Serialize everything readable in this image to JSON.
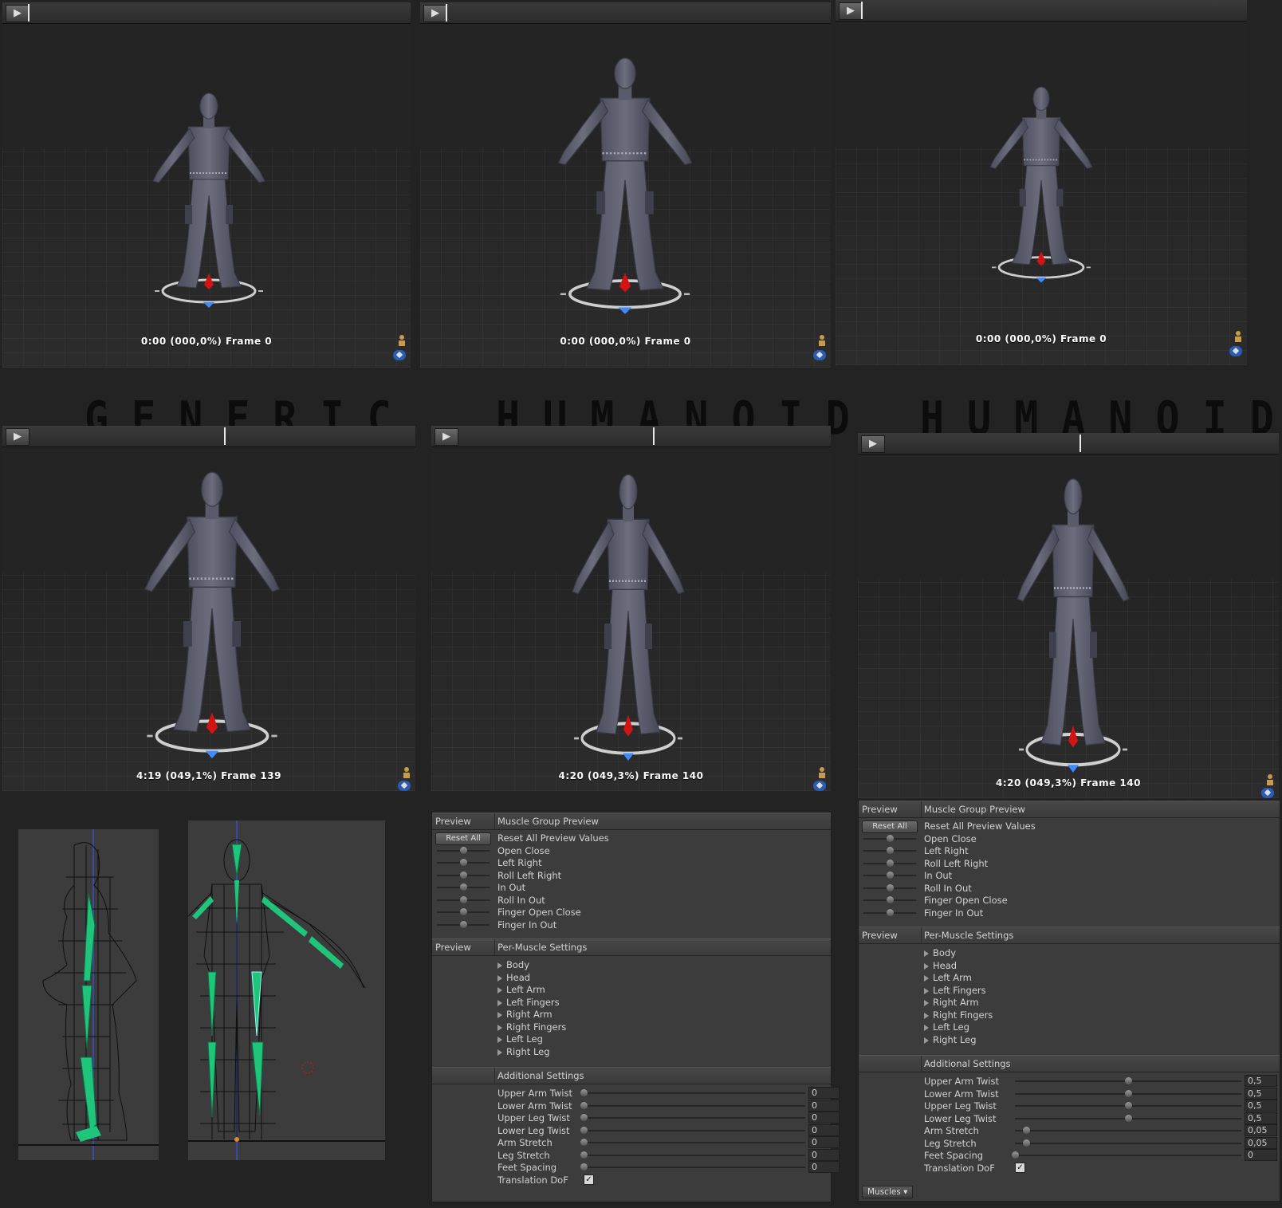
{
  "headers": [
    "GENERIC",
    "HUMANOID",
    "HUMANOID"
  ],
  "viewports": [
    {
      "time": "0:00 (000,0%) Frame 0"
    },
    {
      "time": "0:00 (000,0%) Frame 0"
    },
    {
      "time": "0:00 (000,0%) Frame 0"
    },
    {
      "time": "4:19 (049,1%) Frame 139"
    },
    {
      "time": "4:20 (049,3%) Frame 140"
    },
    {
      "time": "4:20 (049,3%) Frame 140"
    }
  ],
  "inspector_left": {
    "muscle_group": {
      "col_label": "Preview",
      "title": "Muscle Group Preview",
      "reset_button": "Reset All",
      "reset_label": "Reset All Preview Values",
      "items": [
        "Open Close",
        "Left Right",
        "Roll Left Right",
        "In Out",
        "Roll In Out",
        "Finger Open Close",
        "Finger In Out"
      ]
    },
    "per_muscle": {
      "col_label": "Preview",
      "title": "Per-Muscle Settings",
      "items": [
        "Body",
        "Head",
        "Left Arm",
        "Left Fingers",
        "Right Arm",
        "Right Fingers",
        "Left Leg",
        "Right Leg"
      ]
    },
    "additional": {
      "title": "Additional Settings",
      "rows": [
        {
          "label": "Upper Arm Twist",
          "value": "0",
          "fraction": 0
        },
        {
          "label": "Lower Arm Twist",
          "value": "0",
          "fraction": 0
        },
        {
          "label": "Upper Leg Twist",
          "value": "0",
          "fraction": 0
        },
        {
          "label": "Lower Leg Twist",
          "value": "0",
          "fraction": 0
        },
        {
          "label": "Arm Stretch",
          "value": "0",
          "fraction": 0
        },
        {
          "label": "Leg Stretch",
          "value": "0",
          "fraction": 0
        },
        {
          "label": "Feet Spacing",
          "value": "0",
          "fraction": 0
        }
      ],
      "translation_dof": "Translation DoF",
      "translation_checked": true
    }
  },
  "inspector_right": {
    "muscle_group": {
      "col_label": "Preview",
      "title": "Muscle Group Preview",
      "reset_button": "Reset All",
      "reset_label": "Reset All Preview Values",
      "items": [
        "Open Close",
        "Left Right",
        "Roll Left Right",
        "In Out",
        "Roll In Out",
        "Finger Open Close",
        "Finger In Out"
      ]
    },
    "per_muscle": {
      "col_label": "Preview",
      "title": "Per-Muscle Settings",
      "items": [
        "Body",
        "Head",
        "Left Arm",
        "Left Fingers",
        "Right Arm",
        "Right Fingers",
        "Left Leg",
        "Right Leg"
      ]
    },
    "additional": {
      "title": "Additional Settings",
      "rows": [
        {
          "label": "Upper Arm Twist",
          "value": "0,5",
          "fraction": 0.5
        },
        {
          "label": "Lower Arm Twist",
          "value": "0,5",
          "fraction": 0.5
        },
        {
          "label": "Upper Leg Twist",
          "value": "0,5",
          "fraction": 0.5
        },
        {
          "label": "Lower Leg Twist",
          "value": "0,5",
          "fraction": 0.5
        },
        {
          "label": "Arm Stretch",
          "value": "0,05",
          "fraction": 0.05
        },
        {
          "label": "Leg Stretch",
          "value": "0,05",
          "fraction": 0.05
        },
        {
          "label": "Feet Spacing",
          "value": "0",
          "fraction": 0
        }
      ],
      "translation_dof": "Translation DoF",
      "translation_checked": true
    },
    "footer_tab": "Muscles ▾"
  },
  "colors": {
    "bone_green": "#1fc57a",
    "ik_red": "#d21414",
    "tag_blue": "#2a5cb4"
  }
}
